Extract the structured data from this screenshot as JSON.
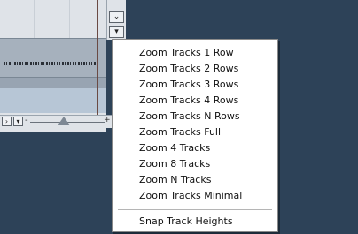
{
  "scrollbars": {
    "vertical": {
      "down_arrow": "⌄",
      "menu_arrow": "▾"
    },
    "bottom": {
      "right_arrow": "›",
      "menu_arrow": "▾",
      "zoom_minus": "-",
      "zoom_plus": "+",
      "zoom_level": 0.45
    }
  },
  "menu": {
    "items": [
      "Zoom Tracks 1 Row",
      "Zoom Tracks 2 Rows",
      "Zoom Tracks 3 Rows",
      "Zoom Tracks 4 Rows",
      "Zoom Tracks N Rows",
      "Zoom Tracks Full",
      "Zoom 4 Tracks",
      "Zoom 8 Tracks",
      "Zoom N Tracks",
      "Zoom Tracks Minimal"
    ],
    "footer_item": "Snap Track Heights"
  },
  "colors": {
    "background": "#2d4258",
    "menu_bg": "#ffffff",
    "event_bg": "#a6b1bd"
  }
}
